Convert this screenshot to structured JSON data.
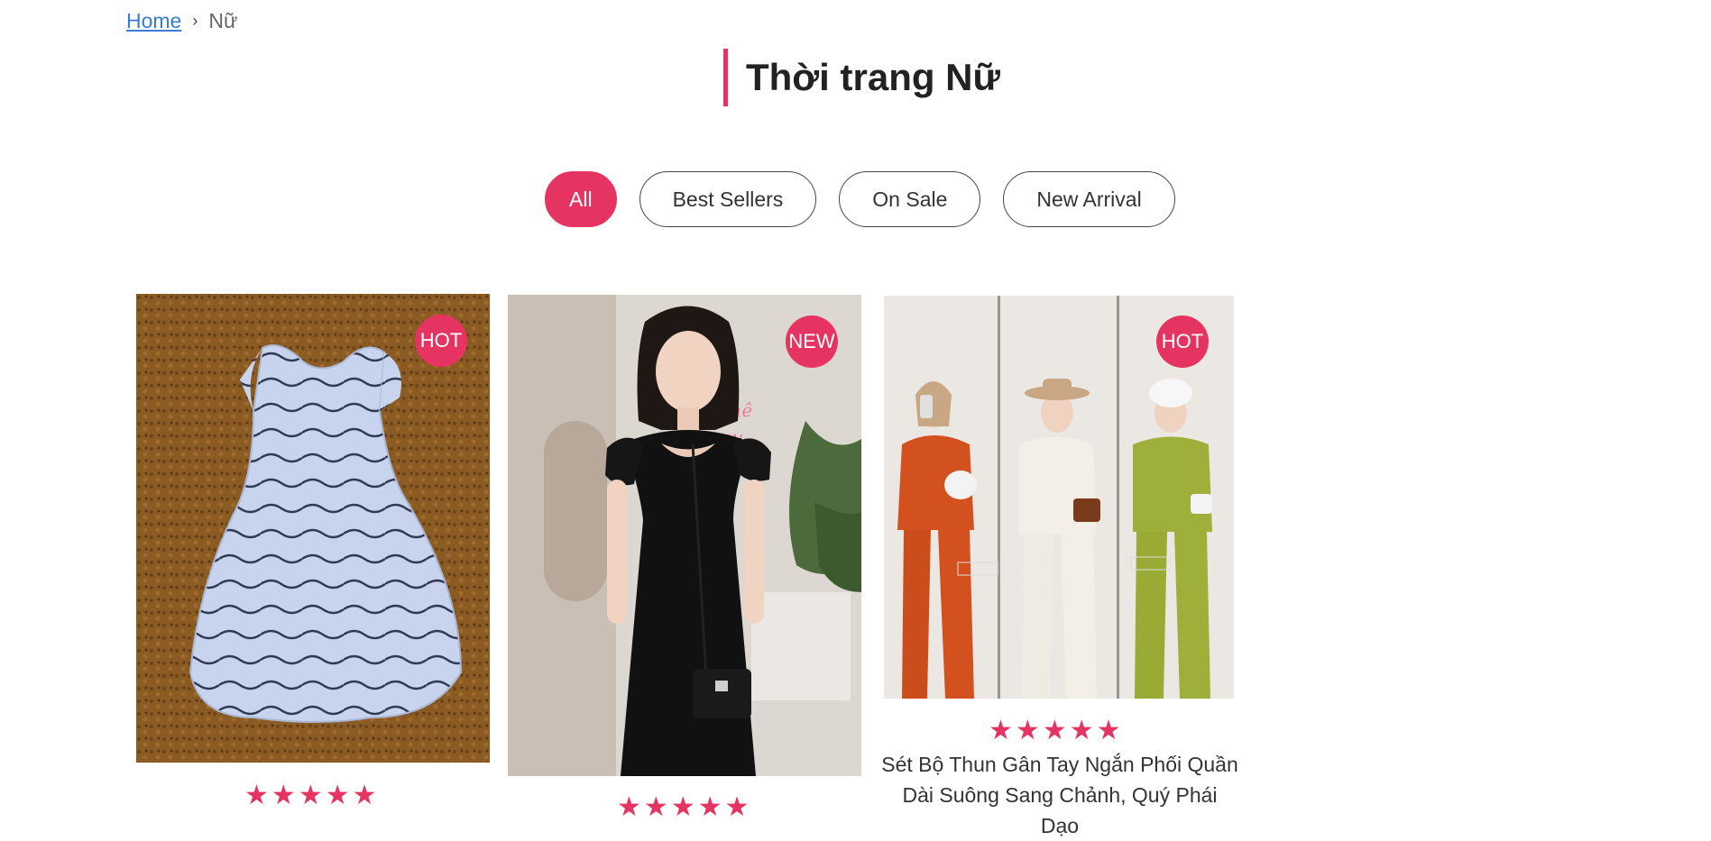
{
  "breadcrumb": {
    "home": "Home",
    "current": "Nữ"
  },
  "page": {
    "title": "Thời trang Nữ"
  },
  "filters": [
    "All",
    "Best Sellers",
    "On Sale",
    "New Arrival"
  ],
  "products": [
    {
      "badge": "HOT",
      "image": "blue-white-wave-striped-dress",
      "rating": 5
    },
    {
      "badge": "NEW",
      "image": "black-dress-model",
      "rating": 5
    },
    {
      "badge": "HOT",
      "image": "three-women-pleated-sets",
      "rating": 5,
      "name_line1": "Sét Bộ Thun Gân Tay Ngắn Phối Quần",
      "name_line2": "Dài Suông Sang Chảnh, Quý Phái Dạo"
    }
  ],
  "colors": {
    "accent": "#e63462",
    "link": "#3a7bd5"
  }
}
